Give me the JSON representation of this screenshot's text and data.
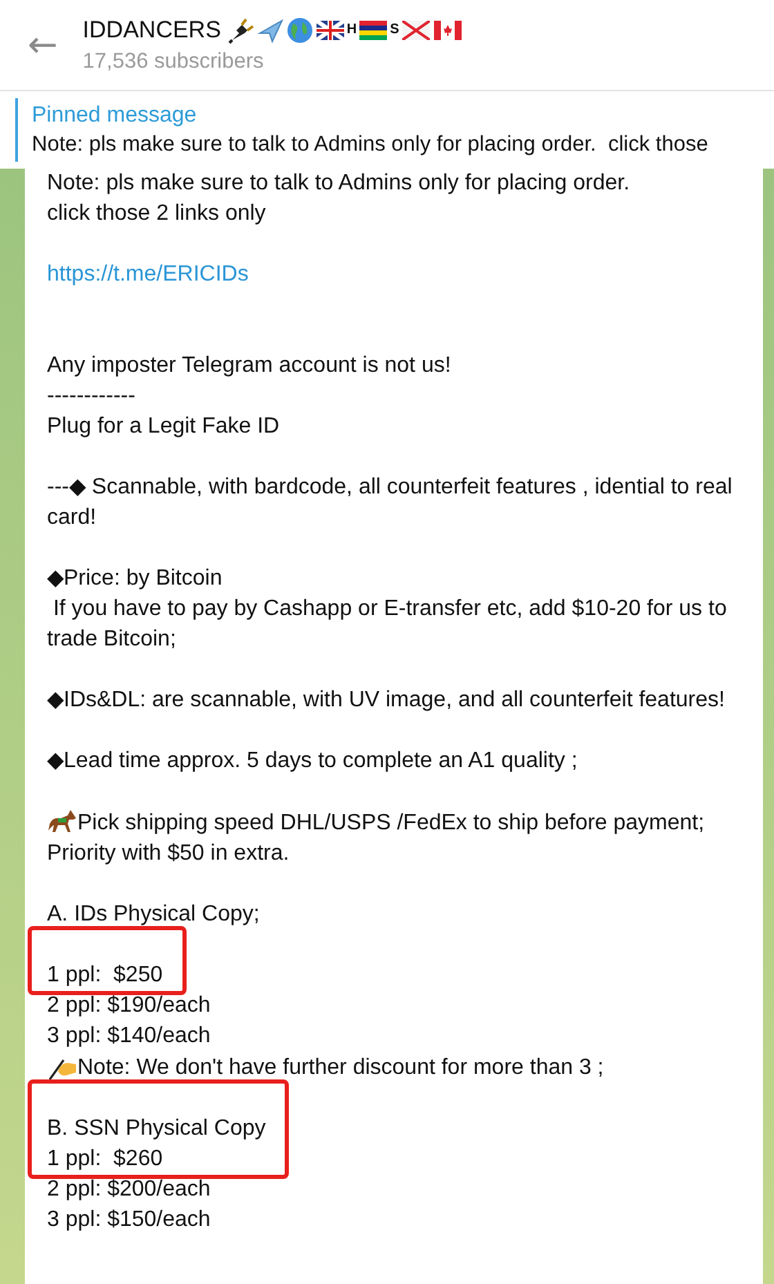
{
  "header": {
    "back": "←",
    "title": "IDDANCERS",
    "title_marks": [
      {
        "kind": "plug"
      },
      {
        "kind": "plane"
      },
      {
        "kind": "globe"
      },
      {
        "kind": "flag-uk"
      },
      {
        "kind": "letter",
        "text": "H"
      },
      {
        "kind": "flag-mu"
      },
      {
        "kind": "letter",
        "text": "S"
      },
      {
        "kind": "flag-je"
      },
      {
        "kind": "flag-ca"
      }
    ],
    "subtitle": "17,536 subscribers"
  },
  "pinned": {
    "label": "Pinned message",
    "text": "Note: pls make sure to talk to Admins only for placing order.  click those"
  },
  "message": {
    "lines": [
      {
        "kind": "text",
        "text": "Note: pls make sure to talk to Admins only for placing order."
      },
      {
        "kind": "text",
        "text": "click those 2 links only"
      },
      {
        "kind": "blank"
      },
      {
        "kind": "link",
        "text": "https://t.me/ERICIDs"
      },
      {
        "kind": "blank"
      },
      {
        "kind": "blank"
      },
      {
        "kind": "text",
        "text": "Any imposter Telegram account is not us!"
      },
      {
        "kind": "text",
        "text": "------------"
      },
      {
        "kind": "text",
        "text": "Plug for a Legit Fake ID"
      },
      {
        "kind": "blank"
      },
      {
        "kind": "text",
        "text": "---◆ Scannable, with bardcode, all counterfeit features , idential to real card!"
      },
      {
        "kind": "blank"
      },
      {
        "kind": "text",
        "text": "◆Price: by Bitcoin"
      },
      {
        "kind": "text",
        "text": " If you have to pay by Cashapp or E-transfer etc, add $10-20 for us to trade Bitcoin;"
      },
      {
        "kind": "blank"
      },
      {
        "kind": "text",
        "text": "◆IDs&DL: are scannable, with UV image, and all counterfeit features!"
      },
      {
        "kind": "blank"
      },
      {
        "kind": "text",
        "text": "◆Lead time approx. 5 days to complete an A1 quality ;"
      },
      {
        "kind": "blank"
      },
      {
        "kind": "shipping",
        "text": "Pick shipping speed DHL/USPS /FedEx to ship before payment;"
      },
      {
        "kind": "text",
        "text": "Priority with $50 in extra."
      },
      {
        "kind": "blank"
      },
      {
        "kind": "text",
        "text": "A. IDs Physical Copy;"
      },
      {
        "kind": "frame",
        "lines": [
          {
            "kind": "blank"
          },
          {
            "kind": "text",
            "text": "1 ppl:  $250"
          }
        ]
      },
      {
        "kind": "text",
        "text": "2 ppl: $190/each"
      },
      {
        "kind": "text",
        "text": "3 ppl: $140/each"
      },
      {
        "kind": "note",
        "text": "Note: We don't have further discount for more than 3 ;"
      },
      {
        "kind": "frame",
        "lines": [
          {
            "kind": "blank"
          },
          {
            "kind": "text",
            "text": "B. SSN Physical Copy"
          },
          {
            "kind": "text",
            "text": "1 ppl:  $260"
          }
        ]
      },
      {
        "kind": "text",
        "text": "2 ppl: $200/each"
      },
      {
        "kind": "text",
        "text": "3 ppl: $150/each"
      }
    ]
  }
}
